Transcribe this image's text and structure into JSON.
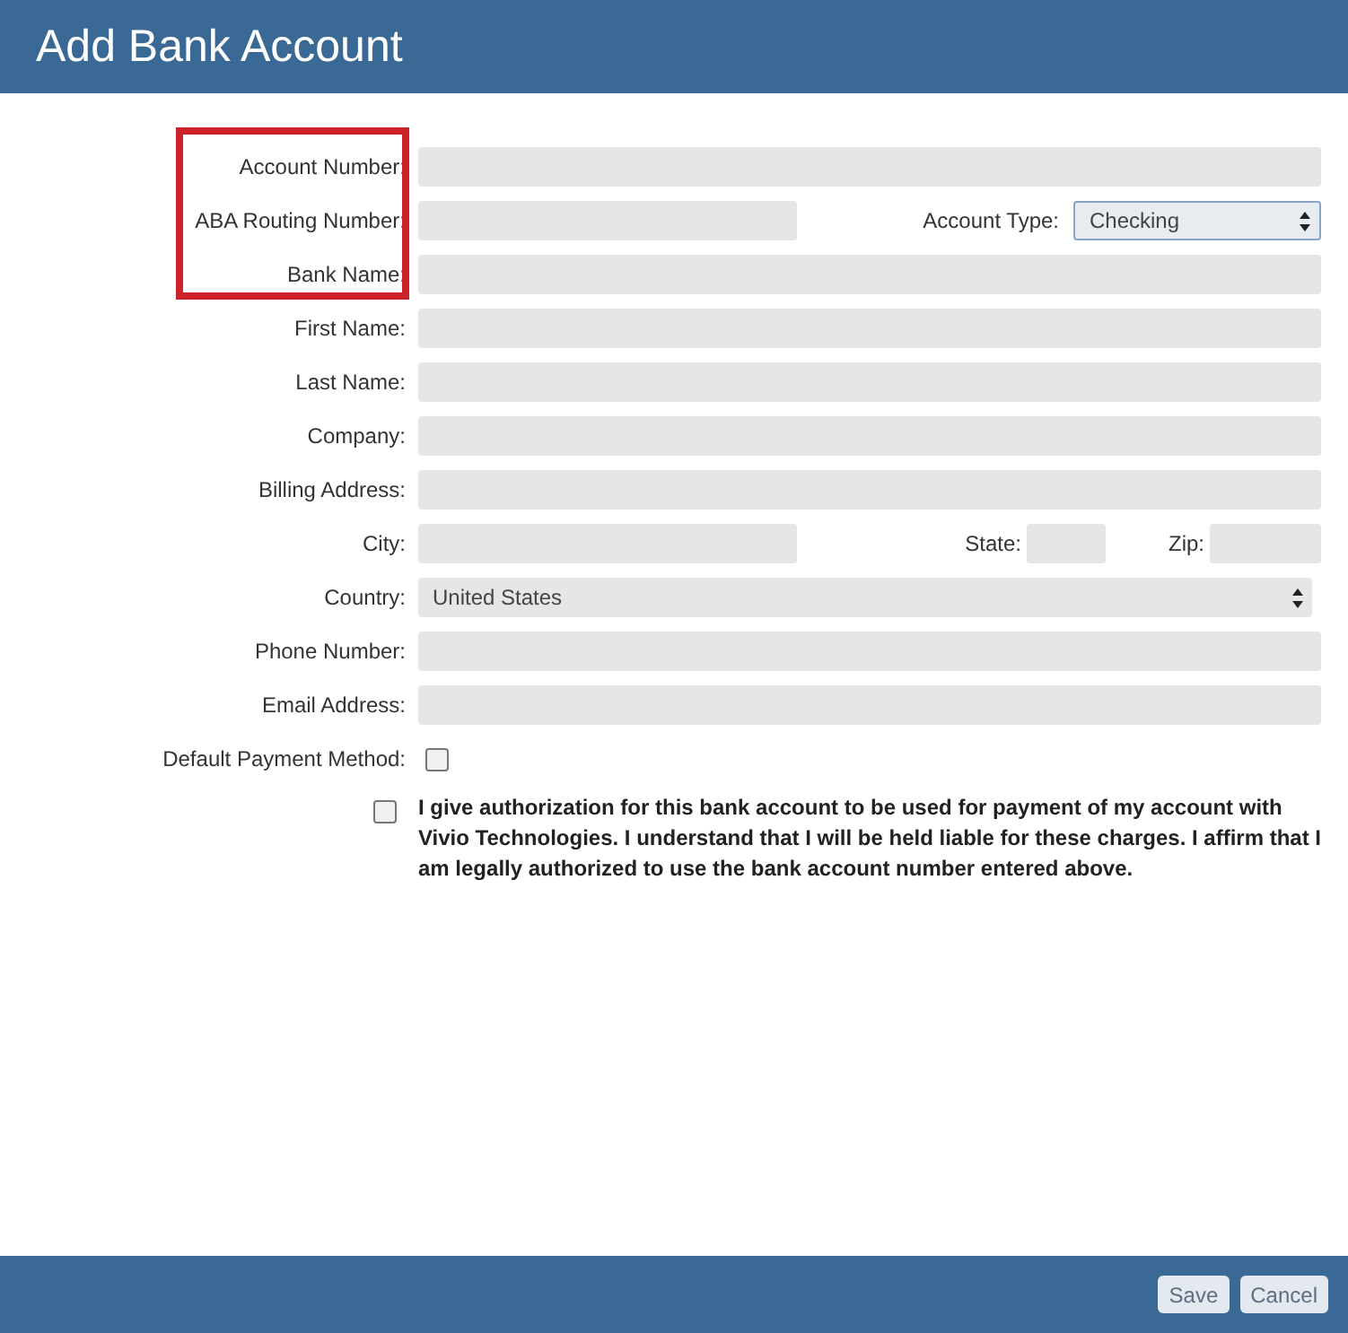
{
  "window": {
    "title": "Add Bank Account"
  },
  "rows": [
    {
      "kind": "text",
      "label": "Account Number:",
      "highlighted": true
    },
    {
      "kind": "split",
      "label": "ABA Routing Number:",
      "highlighted": true,
      "extra": {
        "label": "Account Type:",
        "value": "Checking",
        "focused": true
      }
    },
    {
      "kind": "text",
      "label": "Bank Name:",
      "highlighted": true
    },
    {
      "kind": "text",
      "label": "First Name:",
      "highlighted": false
    },
    {
      "kind": "text",
      "label": "Last Name:",
      "highlighted": false
    },
    {
      "kind": "text",
      "label": "Company:",
      "highlighted": false
    },
    {
      "kind": "text",
      "label": "Billing Address:",
      "highlighted": false
    },
    {
      "kind": "address",
      "label": "City:",
      "highlighted": false,
      "extras": [
        {
          "label": "State:",
          "kind": "state"
        },
        {
          "label": "Zip:",
          "kind": "zip"
        }
      ]
    },
    {
      "kind": "select",
      "label": "Country:",
      "highlighted": false,
      "value": "United States"
    },
    {
      "kind": "text",
      "label": "Phone Number:",
      "highlighted": false
    },
    {
      "kind": "text",
      "label": "Email Address:",
      "highlighted": false
    },
    {
      "kind": "checkbox",
      "label": "Default Payment Method:",
      "highlighted": false,
      "checked": false
    }
  ],
  "authorization": {
    "checked": false,
    "text": "I give authorization for this bank account to be used for payment of my account with Vivio Technologies. I understand that I will be held liable for these charges. I affirm that I am legally authorized to use the bank account number entered above."
  },
  "buttons": [
    {
      "label": "Save"
    },
    {
      "label": "Cancel"
    }
  ]
}
